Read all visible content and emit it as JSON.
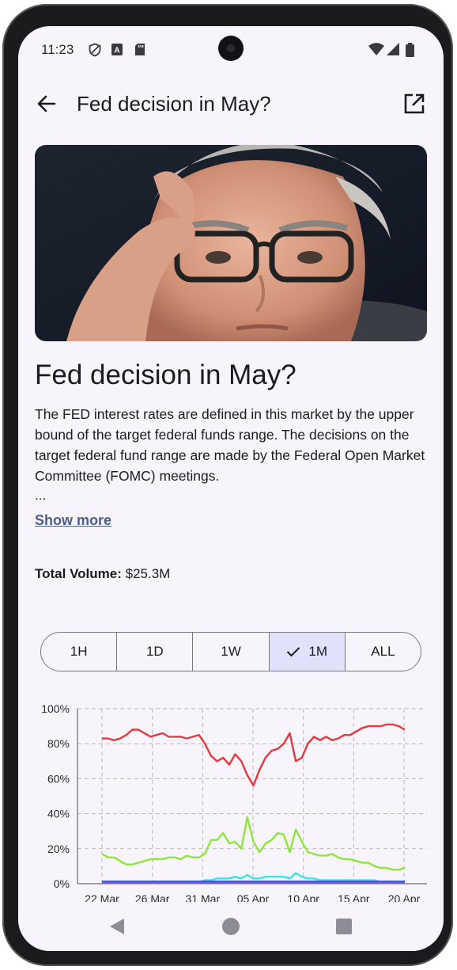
{
  "status_bar": {
    "time": "11:23"
  },
  "app_bar": {
    "title": "Fed decision in May?"
  },
  "market": {
    "heading": "Fed decision in May?",
    "description": "The FED interest rates are defined in this market by the upper bound of the target federal funds range. The decisions on the target federal fund range are made by the Federal Open Market Committee (FOMC) meetings.",
    "ellipsis": "...",
    "show_more": "Show more",
    "volume_label": "Total Volume:",
    "volume_value": "$25.3M"
  },
  "time_ranges": {
    "options": [
      "1H",
      "1D",
      "1W",
      "1M",
      "ALL"
    ],
    "selected": "1M"
  },
  "chart_data": {
    "type": "line",
    "title": "",
    "y_ticks": [
      "100%",
      "80%",
      "60%",
      "40%",
      "20%",
      "0%"
    ],
    "x_ticks": [
      "22 Mar",
      "26 Mar",
      "31 Mar",
      "05 Apr",
      "10 Apr",
      "15 Apr",
      "20 Apr"
    ],
    "ylim": [
      0,
      100
    ],
    "grid": true,
    "series": [
      {
        "color": "#e8383d",
        "values": [
          83,
          83,
          82,
          83,
          85,
          88,
          88,
          86,
          84,
          85,
          86,
          84,
          84,
          84,
          83,
          84,
          85,
          80,
          73,
          70,
          72,
          68,
          74,
          70,
          62,
          56,
          65,
          72,
          76,
          77,
          80,
          86,
          70,
          72,
          80,
          84,
          82,
          84,
          82,
          83,
          85,
          85,
          87,
          89,
          90,
          90,
          90,
          91,
          91,
          90,
          88
        ]
      },
      {
        "color": "#8ee63a",
        "values": [
          17,
          15,
          15,
          13,
          11,
          11,
          12,
          13,
          14,
          14,
          14,
          15,
          15,
          14,
          16,
          15,
          15,
          17,
          25,
          25,
          29,
          23,
          24,
          20,
          38,
          24,
          18,
          23,
          25,
          29,
          28,
          18,
          31,
          24,
          18,
          17,
          16,
          16,
          17,
          15,
          14,
          14,
          13,
          12,
          12,
          10,
          9,
          9,
          8,
          8,
          9
        ]
      },
      {
        "color": "#3fe0e8",
        "values": [
          1,
          1,
          1,
          1,
          1,
          1,
          1,
          1,
          1,
          1,
          1,
          1,
          1,
          1,
          1,
          1,
          1,
          2,
          2,
          3,
          3,
          3,
          4,
          3,
          5,
          3,
          3,
          4,
          4,
          4,
          4,
          3,
          6,
          4,
          3,
          3,
          2,
          2,
          2,
          2,
          2,
          2,
          2,
          2,
          2,
          2,
          1,
          1,
          1,
          1,
          1
        ]
      },
      {
        "color": "#9a50d8",
        "values": [
          0.5,
          0.5,
          0.5,
          0.5,
          0.5,
          0.5,
          0.5,
          0.5,
          0.5,
          0.5,
          0.5,
          0.5,
          0.5,
          0.5,
          0.5,
          0.5,
          0.5,
          0.5,
          0.5,
          0.5,
          0.5,
          0.5,
          0.5,
          0.5,
          0.5,
          0.5,
          0.5,
          0.5,
          0.5,
          0.5,
          0.5,
          0.5,
          0.5,
          0.5,
          0.5,
          0.5,
          0.5,
          0.5,
          0.5,
          0.5,
          0.5,
          0.5,
          0.5,
          0.5,
          0.5,
          0.5,
          0.5,
          0.5,
          0.5,
          0.5,
          0.5
        ]
      },
      {
        "color": "#3b5bd8",
        "values": [
          1.2,
          1.2,
          1.2,
          1.2,
          1.2,
          1.2,
          1.2,
          1.2,
          1.2,
          1.2,
          1.2,
          1.2,
          1.2,
          1.2,
          1.2,
          1.2,
          1.2,
          1.2,
          1.2,
          1.2,
          1.2,
          1.2,
          1.2,
          1.2,
          1.2,
          1.2,
          1.2,
          1.2,
          1.2,
          1.2,
          1.2,
          1.2,
          1.2,
          1.2,
          1.2,
          1.2,
          1.2,
          1.2,
          1.2,
          1.2,
          1.2,
          1.2,
          1.2,
          1.2,
          1.2,
          1.2,
          1.2,
          1.2,
          1.2,
          1.2,
          1.2
        ]
      }
    ]
  },
  "nav_bar": {
    "back": "back-nav-icon",
    "home": "home-nav-icon",
    "recents": "recents-nav-icon"
  }
}
